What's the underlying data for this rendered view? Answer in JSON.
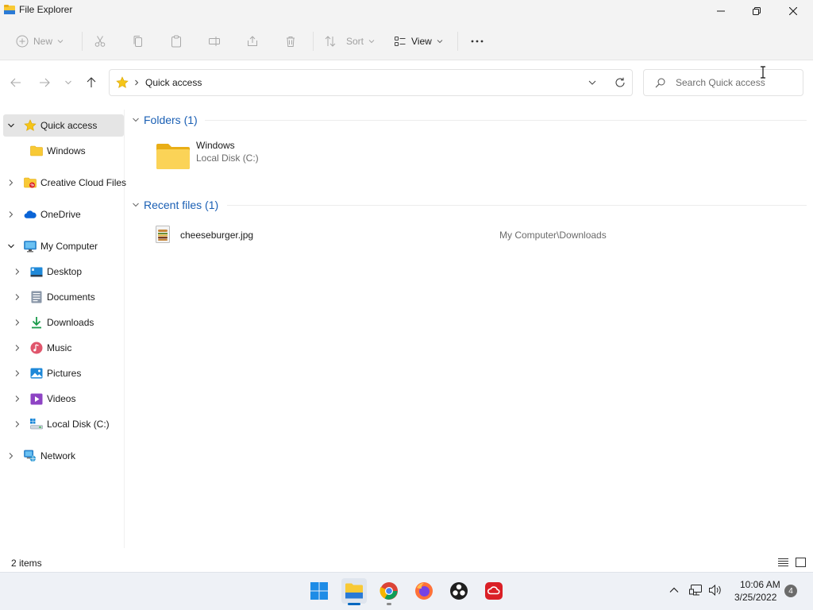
{
  "window": {
    "title": "File Explorer"
  },
  "commandbar": {
    "new_label": "New",
    "sort_label": "Sort",
    "view_label": "View",
    "more_label": "···"
  },
  "address": {
    "location": "Quick access",
    "search_placeholder": "Search Quick access"
  },
  "sidebar": {
    "items": [
      {
        "label": "Quick access",
        "icon": "star-icon",
        "expanded": true,
        "selected": true
      },
      {
        "label": "Windows",
        "icon": "folder-icon"
      },
      {
        "label": "Creative Cloud Files",
        "icon": "creative-cloud-folder-icon"
      },
      {
        "label": "OneDrive",
        "icon": "onedrive-cloud-icon"
      },
      {
        "label": "My Computer",
        "icon": "monitor-icon",
        "expanded": true
      },
      {
        "label": "Desktop",
        "icon": "desktop-icon"
      },
      {
        "label": "Documents",
        "icon": "documents-icon"
      },
      {
        "label": "Downloads",
        "icon": "download-arrow-icon"
      },
      {
        "label": "Music",
        "icon": "music-icon"
      },
      {
        "label": "Pictures",
        "icon": "pictures-icon"
      },
      {
        "label": "Videos",
        "icon": "videos-icon"
      },
      {
        "label": "Local Disk (C:)",
        "icon": "drive-icon"
      },
      {
        "label": "Network",
        "icon": "network-icon"
      }
    ]
  },
  "main": {
    "folders_header": "Folders (1)",
    "folders": [
      {
        "name": "Windows",
        "location": "Local Disk (C:)"
      }
    ],
    "recent_header": "Recent files (1)",
    "recent_files": [
      {
        "name": "cheeseburger.jpg",
        "path": "My Computer\\Downloads"
      }
    ]
  },
  "statusbar": {
    "item_count": "2 items"
  },
  "taskbar": {
    "apps": [
      "start-icon",
      "file-explorer-icon",
      "chrome-icon",
      "firefox-icon",
      "obs-icon",
      "creative-cloud-icon"
    ],
    "time": "10:06 AM",
    "date": "3/25/2022",
    "notification_count": "4"
  },
  "colors": {
    "accent": "#0067c0",
    "group_header": "#1a5fb4",
    "selected_bg": "#e5e5e5",
    "folder_yellow": "#f8c935"
  }
}
